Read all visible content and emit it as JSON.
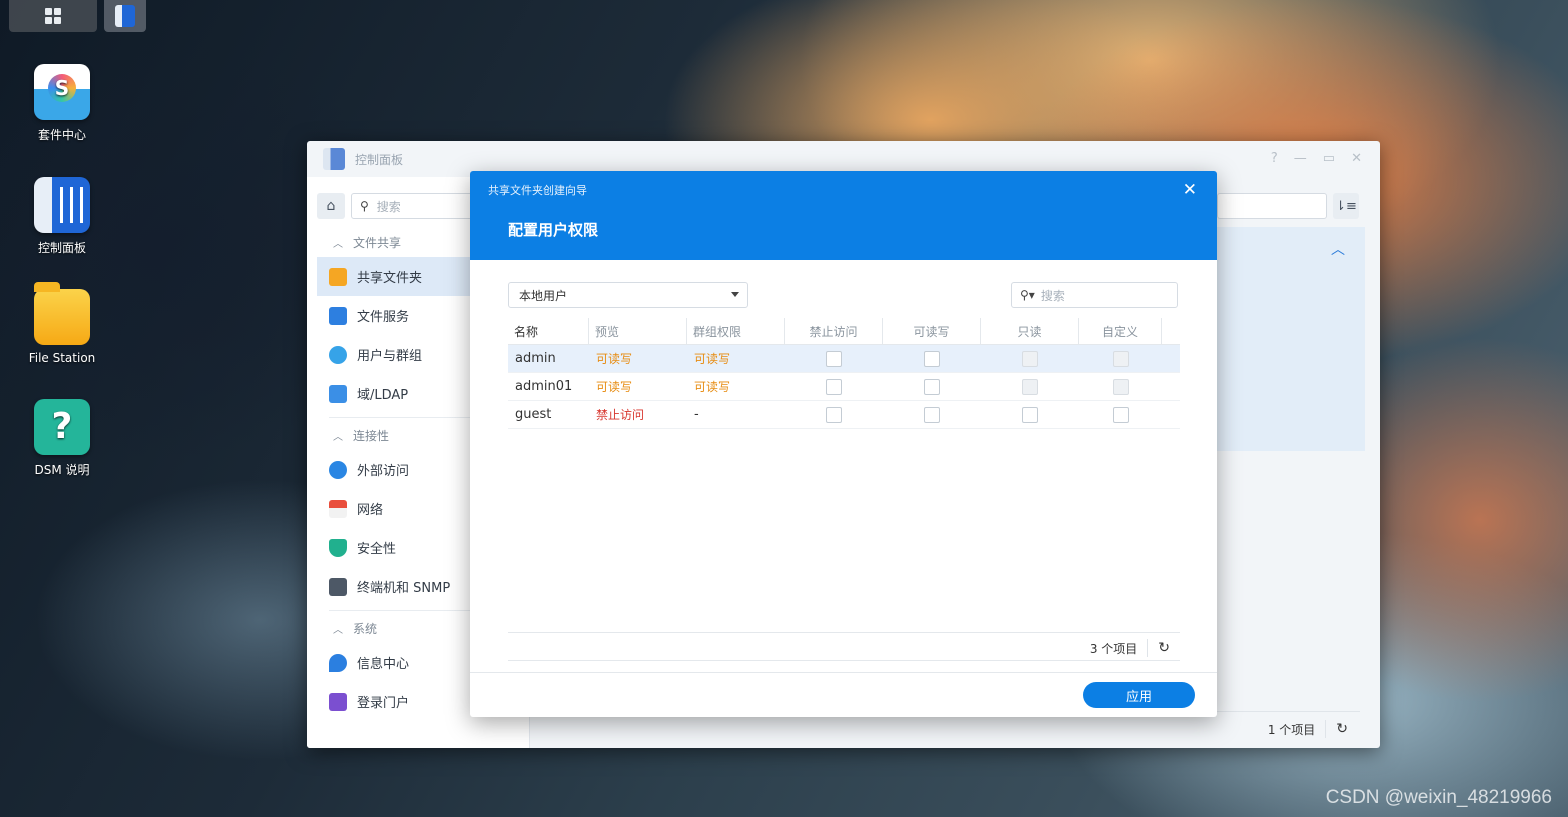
{
  "desktop": {
    "icons": [
      {
        "label": "套件中心"
      },
      {
        "label": "控制面板"
      },
      {
        "label": "File Station"
      },
      {
        "label": "DSM 说明"
      }
    ],
    "watermark": "CSDN @weixin_48219966"
  },
  "control_panel": {
    "title": "控制面板",
    "search_placeholder": "搜索",
    "sections": {
      "file_sharing": "文件共享",
      "connectivity": "连接性",
      "system": "系统"
    },
    "items": {
      "shared_folder": "共享文件夹",
      "file_services": "文件服务",
      "users_groups": "用户与群组",
      "domain_ldap": "域/LDAP",
      "external_access": "外部访问",
      "network": "网络",
      "security": "安全性",
      "terminal_snmp": "终端机和 SNMP",
      "info_center": "信息中心",
      "login_portal": "登录门户"
    },
    "footer_count": "1 个项目"
  },
  "wizard": {
    "title": "共享文件夹创建向导",
    "heading": "配置用户权限",
    "user_type": "本地用户",
    "search_placeholder": "搜索",
    "columns": [
      "名称",
      "预览",
      "群组权限",
      "禁止访问",
      "可读写",
      "只读",
      "自定义"
    ],
    "rows": [
      {
        "name": "admin",
        "preview": "可读写",
        "group": "可读写",
        "preview_color": "#e78c12"
      },
      {
        "name": "admin01",
        "preview": "可读写",
        "group": "可读写",
        "preview_color": "#e78c12"
      },
      {
        "name": "guest",
        "preview": "禁止访问",
        "group": "-",
        "preview_color": "#d8372f"
      }
    ],
    "item_count": "3 个项目",
    "apply_label": "应用",
    "accent_color": "#0c7fe4"
  }
}
